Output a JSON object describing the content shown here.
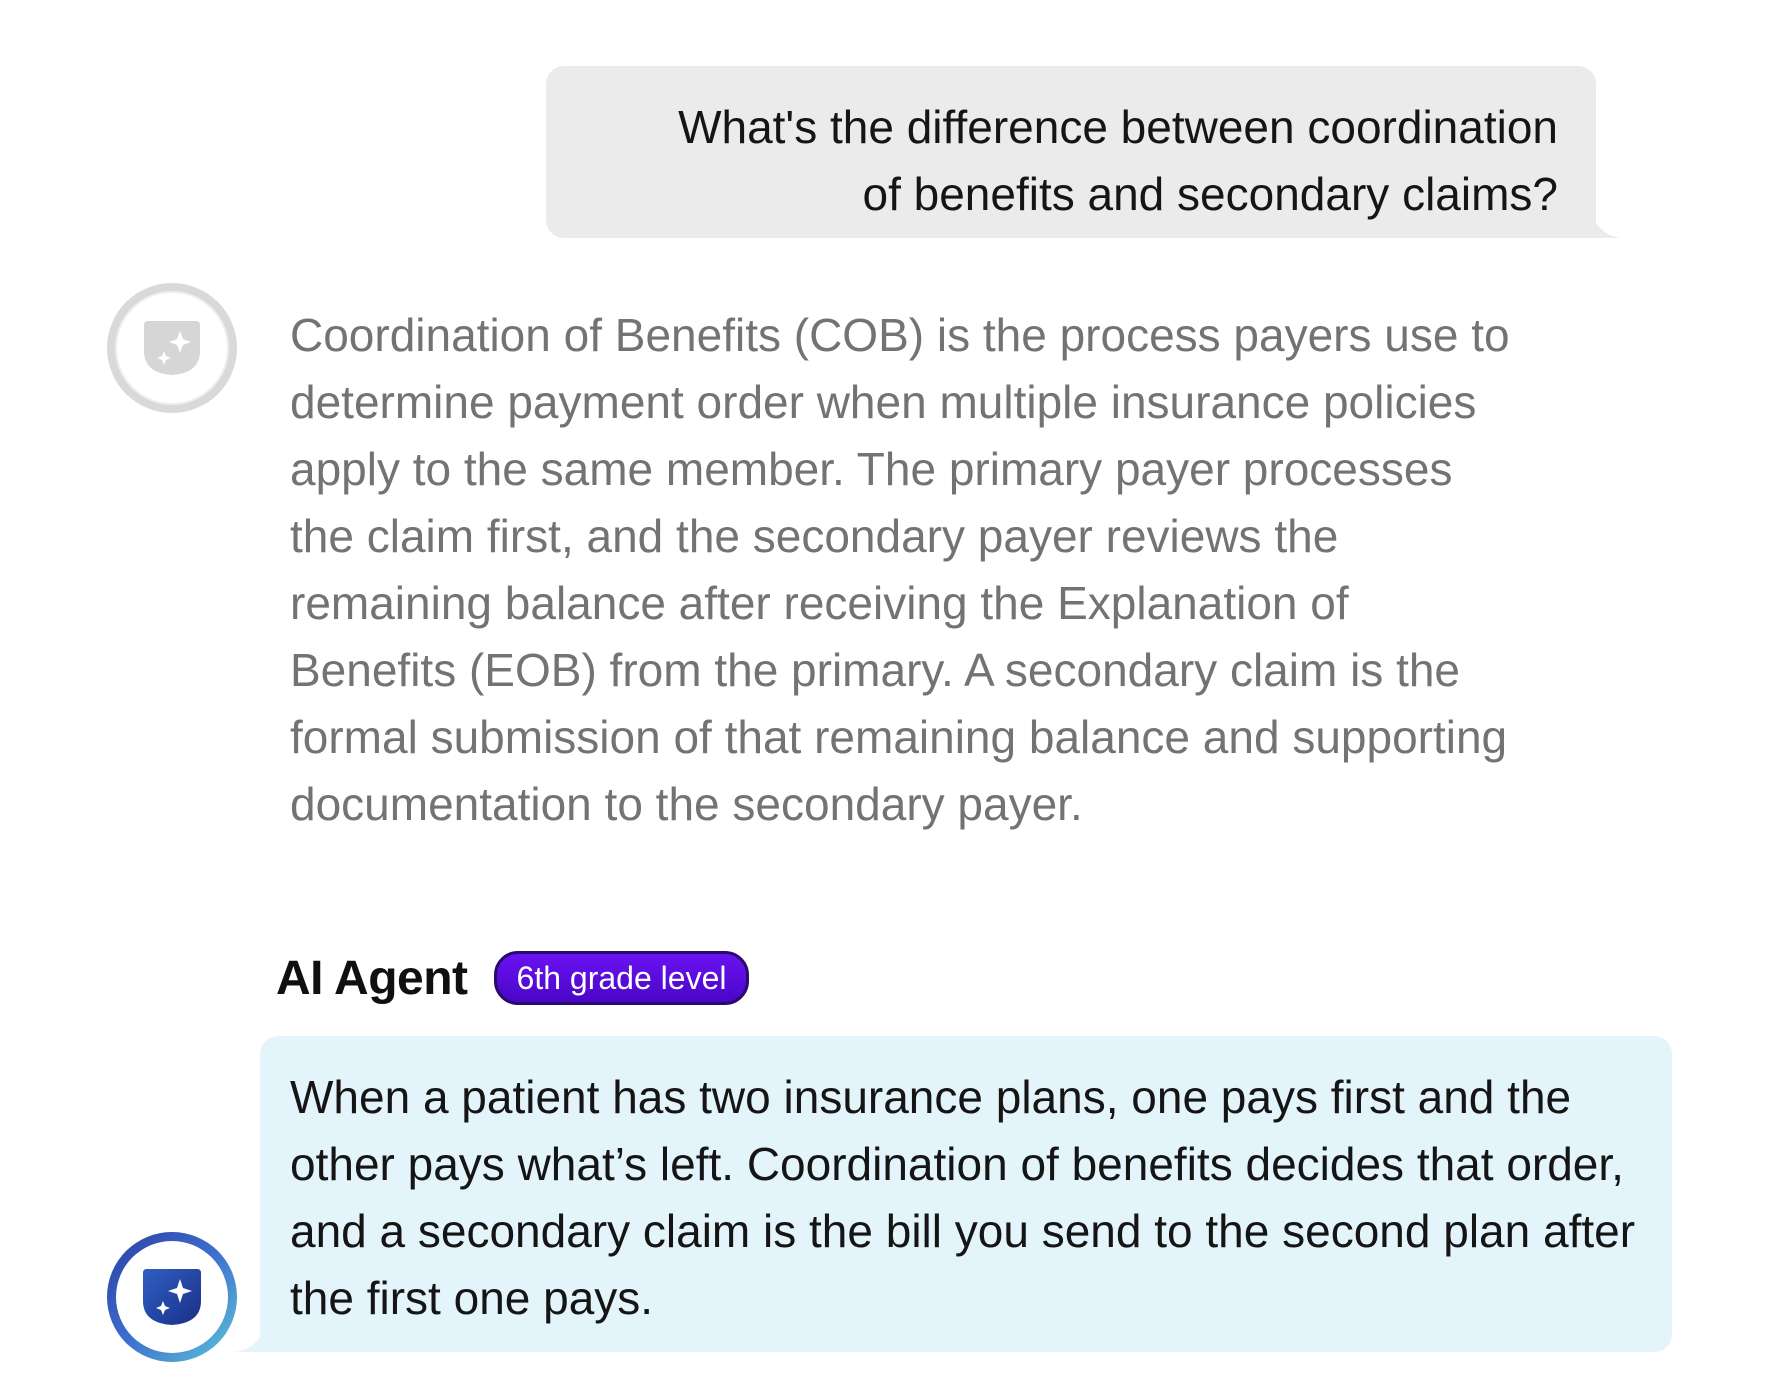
{
  "conversation": {
    "user_message": {
      "line1": "What's the difference between coordination",
      "line2": "of benefits and secondary claims?"
    },
    "original_answer": {
      "avatar_icon": "sparkle-shield-icon",
      "text": "Coordination of Benefits (COB) is the process payers use to determine payment order when multiple insurance policies apply to the same member. The primary payer processes the claim first, and the secondary payer reviews the remaining balance after receiving the Explanation of Benefits (EOB) from the primary. A secondary claim is the formal submission of that remaining balance and supporting documentation to the secondary payer."
    },
    "agent": {
      "name": "AI Agent",
      "badge": "6th grade level",
      "avatar_icon": "sparkle-shield-icon",
      "simplified_answer": "When a patient has two insurance plans, one pays first and the other pays what’s left. Coordination of benefits decides that order, and a secondary claim is the bill you send to the second plan after the first one pays."
    }
  },
  "colors": {
    "user_bubble": "#ebebeb",
    "original_text": "#737373",
    "agent_bubble": "#e4f4fb",
    "badge_bg": "#5a0bdc",
    "badge_border": "#2a0a6d",
    "avatar_blue_start": "#2a3fa0",
    "avatar_blue_end": "#5ec7d6",
    "avatar_gray": "#d9d9d9"
  }
}
